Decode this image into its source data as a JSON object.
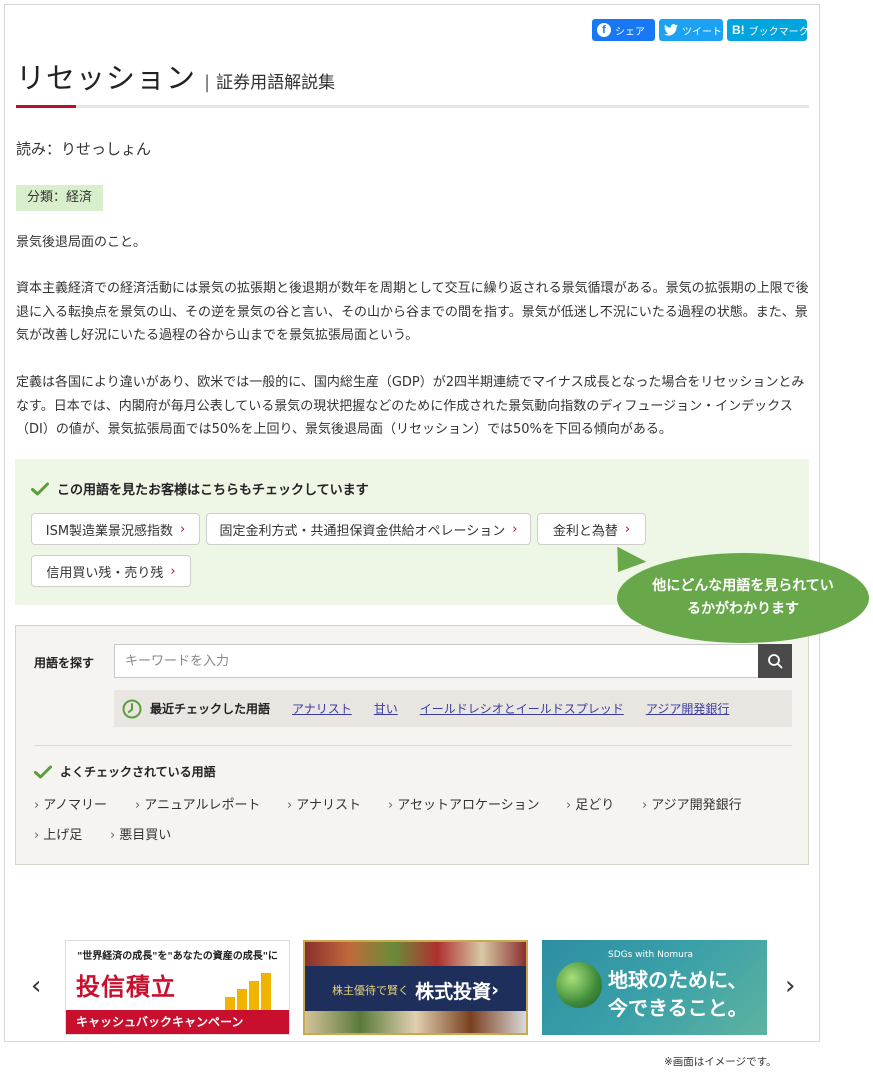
{
  "share": {
    "facebook": "シェア",
    "twitter": "ツイート",
    "hatena": "ブックマーク",
    "hatena_mark": "B!"
  },
  "title": {
    "main": "リセッション",
    "separator": "|",
    "sub": "証券用語解説集"
  },
  "reading": "読み：りせっしょん",
  "category": "分類：経済",
  "body": {
    "p1": "景気後退局面のこと。",
    "p2": "資本主義経済での経済活動には景気の拡張期と後退期が数年を周期として交互に繰り返される景気循環がある。景気の拡張期の上限で後退に入る転換点を景気の山、その逆を景気の谷と言い、その山から谷までの間を指す。景気が低迷し不況にいたる過程の状態。また、景気が改善し好況にいたる過程の谷から山までを景気拡張局面という。",
    "p3": "定義は各国により違いがあり、欧米では一般的に、国内総生産（GDP）が2四半期連続でマイナス成長となった場合をリセッションとみなす。日本では、内閣府が毎月公表している景気の現状把握などのために作成された景気動向指数のディフュージョン・インデックス（DI）の値が、景気拡張局面では50%を上回り、景気後退局面（リセッション）では50%を下回る傾向がある。"
  },
  "related": {
    "heading": "この用語を見たお客様はこちらもチェックしています",
    "tags": [
      "ISM製造業景況感指数",
      "固定金利方式・共通担保資金供給オペレーション",
      "金利と為替",
      "信用買い残・売り残"
    ],
    "chevron": "›"
  },
  "callout": "他にどんな用語を見られているかがわかります",
  "search": {
    "label": "用語を探す",
    "placeholder": "キーワードを入力",
    "recent_label": "最近チェックした用語",
    "recent": [
      "アナリスト",
      "甘い",
      "イールドレシオとイールドスプレッド",
      "アジア開発銀行"
    ],
    "popular_heading": "よくチェックされている用語",
    "popular": [
      "アノマリー",
      "アニュアルレポート",
      "アナリスト",
      "アセットアロケーション",
      "足どり",
      "アジア開発銀行",
      "上げ足",
      "悪目買い"
    ],
    "gt": "›"
  },
  "banners": {
    "b1_top": "\"世界経済の成長\"を\"あなたの資産の成長\"に",
    "b1_main": "投信積立",
    "b1_strip": "キャッシュバックキャンペーン",
    "b2_small": "株主優待で賢く",
    "b2_big": "株式投資",
    "b2_chev": "›",
    "b3_tag": "SDGs with Nomura",
    "b3_line1": "地球のために、",
    "b3_line2": "今できること。"
  },
  "carousel": {
    "prev": "‹",
    "next": "›"
  },
  "footnote": "※画面はイメージです。",
  "colors": {
    "accent_red": "#b8102a",
    "category_bg": "#d9eecb",
    "related_bg": "#eef6e6",
    "callout_green": "#69a84a",
    "link_blue": "#3c3ca0"
  }
}
